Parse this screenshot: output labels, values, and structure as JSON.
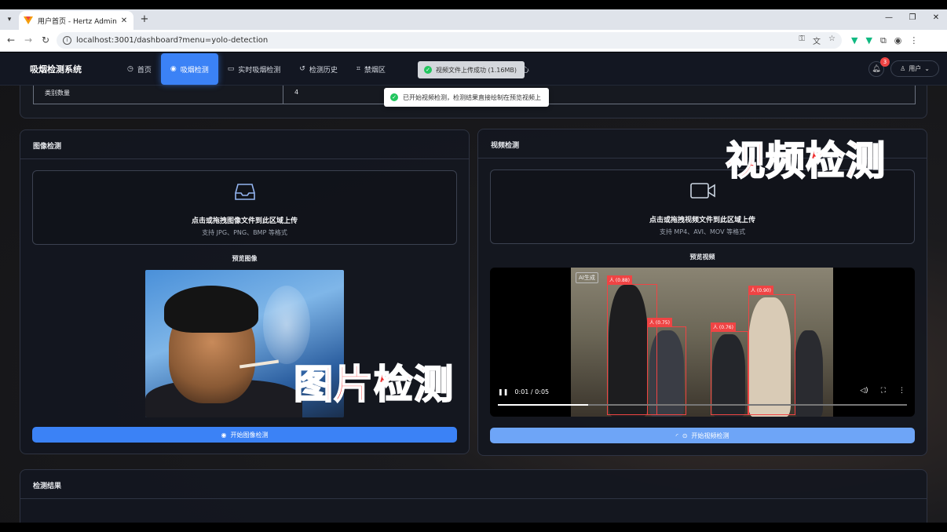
{
  "browser": {
    "tab_title": "用户首页 - Hertz Admin",
    "url": "localhost:3001/dashboard?menu=yolo-detection"
  },
  "app": {
    "brand": "吸烟检测系统",
    "nav": [
      {
        "label": "首页",
        "icon": "dashboard-icon"
      },
      {
        "label": "吸烟检测",
        "icon": "eye-icon"
      },
      {
        "label": "实时吸烟检测",
        "icon": "video-icon"
      },
      {
        "label": "检测历史",
        "icon": "history-icon"
      },
      {
        "label": "禁烟区",
        "icon": "zone-icon"
      },
      {
        "label": "通知中心",
        "icon": "bell-icon"
      }
    ],
    "notif_count": "3",
    "user_label": "用户"
  },
  "toasts": {
    "upload": "视频文件上传成功 (1.16MB)",
    "start": "已开始视频检测，检测结果直接绘制在预览视频上"
  },
  "stats": {
    "key": "类别数量",
    "value": "4"
  },
  "image_panel": {
    "title": "图像检测",
    "drop_main": "点击或拖拽图像文件到此区域上传",
    "drop_sub": "支持 JPG、PNG、BMP 等格式",
    "preview_label": "预览图像",
    "button": "开始图像检测"
  },
  "video_panel": {
    "title": "视频检测",
    "drop_main": "点击或拖拽视频文件到此区域上传",
    "drop_sub": "支持 MP4、AVI、MOV 等格式",
    "preview_label": "预览视频",
    "button": "开始视频检测",
    "ai_tag": "AI生成",
    "time": "0:01 / 0:05",
    "progress": 0.22,
    "detections": [
      {
        "label": "人 (0.88)"
      },
      {
        "label": "人 (0.75)"
      },
      {
        "label": "人 (0.76)"
      },
      {
        "label": "人 (0.90)"
      }
    ]
  },
  "overlays": {
    "video": "视频检测",
    "image": "图片检测"
  },
  "results_panel": {
    "title": "检测结果"
  },
  "colors": {
    "accent": "#3b82f6",
    "detection": "#ef4444",
    "success": "#22c55e"
  }
}
